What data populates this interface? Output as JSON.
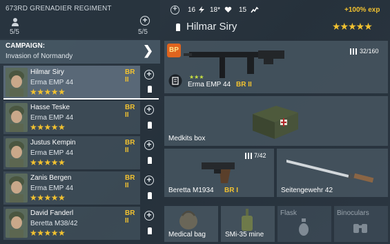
{
  "regiment": {
    "title": "673RD GRENADIER REGIMENT",
    "count_left": "5/5",
    "count_right": "5/5"
  },
  "campaign": {
    "label": "CAMPAIGN:",
    "value": "Invasion of Normandy"
  },
  "soldiers": [
    {
      "name": "Hilmar Siry",
      "rank": "BR II",
      "weapon": "Erma EMP 44",
      "stars": "★★★★★"
    },
    {
      "name": "Hasse Teske",
      "rank": "BR II",
      "weapon": "Erma EMP 44",
      "stars": "★★★★★"
    },
    {
      "name": "Justus Kempin",
      "rank": "BR II",
      "weapon": "Erma EMP 44",
      "stars": "★★★★★"
    },
    {
      "name": "Zanis Bergen",
      "rank": "BR II",
      "weapon": "Erma EMP 44",
      "stars": "★★★★★"
    },
    {
      "name": "David Fanderl",
      "rank": "BR II",
      "weapon": "Beretta M38/42",
      "stars": "★★★★★"
    }
  ],
  "topbar": {
    "stat_a": "16",
    "stat_b": "18*",
    "stat_c": "15",
    "exp_bonus": "+100% exp"
  },
  "selected": {
    "name": "Hilmar Siry",
    "stars": "★★★★★"
  },
  "primary_weapon": {
    "name": "Erma EMP 44",
    "rank": "BR II",
    "ammo": "32/160",
    "mini_stars": "★★★",
    "badge": "BP"
  },
  "medkits": {
    "label": "Medkits box"
  },
  "secondary": {
    "name": "Beretta M1934",
    "rank": "BR I",
    "ammo": "7/42"
  },
  "melee": {
    "label": "Seitengewehr 42"
  },
  "equipment": [
    {
      "label": "Medical bag"
    },
    {
      "label": "SMi-35 mine"
    },
    {
      "label": "Flask"
    },
    {
      "label": "Binoculars"
    }
  ],
  "colors": {
    "accent_yellow": "#f2c230",
    "panel": "#465460",
    "background": "#2b3641"
  },
  "icons": [
    "person-icon",
    "plus-icon",
    "chevron-right-icon",
    "ammo-icon",
    "heart-icon",
    "lightning-icon",
    "stamina-icon",
    "bullets-icon",
    "book-icon"
  ]
}
